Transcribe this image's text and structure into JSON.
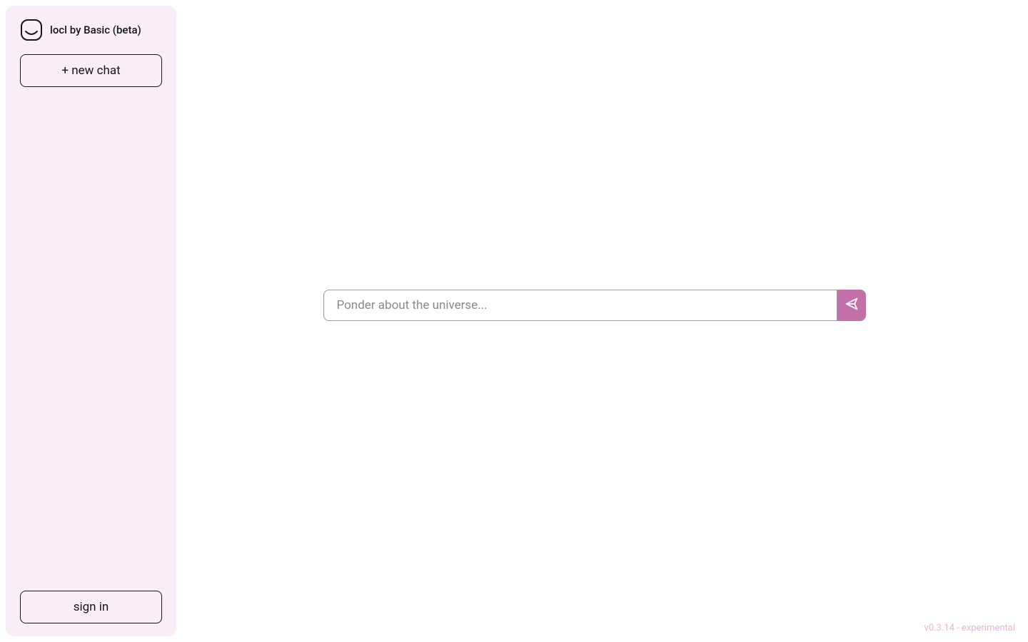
{
  "sidebar": {
    "title": "locl by Basic (beta)",
    "new_chat_label": "+ new chat",
    "sign_in_label": "sign in"
  },
  "chat": {
    "placeholder": "Ponder about the universe...",
    "value": ""
  },
  "footer": {
    "version": "v0.3.14 - experimental"
  },
  "colors": {
    "sidebar_bg": "#f9eef7",
    "accent": "#c270a7",
    "version_text": "#e8b5d8"
  },
  "icons": {
    "logo": "rounded-square-smile",
    "send": "send-icon"
  }
}
